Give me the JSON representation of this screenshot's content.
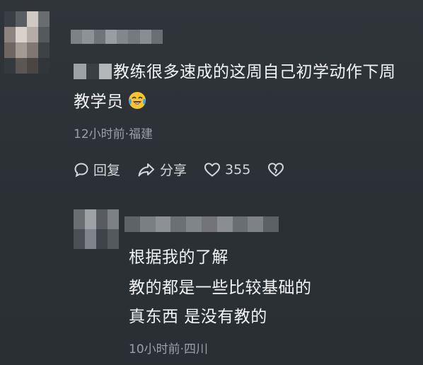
{
  "comment": {
    "text_line1": "教练很多速成的这周自己初学动作下周",
    "text_line2": "教学员",
    "emoji_icon": "laughing-crying-face-icon",
    "meta": "12小时前·福建"
  },
  "actions": {
    "reply_label": "回复",
    "share_label": "分享",
    "like_count": "355",
    "dislike_icon": "broken-heart-icon"
  },
  "reply": {
    "line1": "根据我的了解",
    "line2": "教的都是一些比较基础的",
    "line3": "真东西 是没有教的",
    "meta": "10小时前·四川"
  },
  "colors": {
    "background": "#2c3136",
    "text": "#f3f4f5",
    "meta": "#9aa0a6",
    "emoji_yellow": "#f7c531",
    "emoji_blue": "#3b9ef0"
  }
}
